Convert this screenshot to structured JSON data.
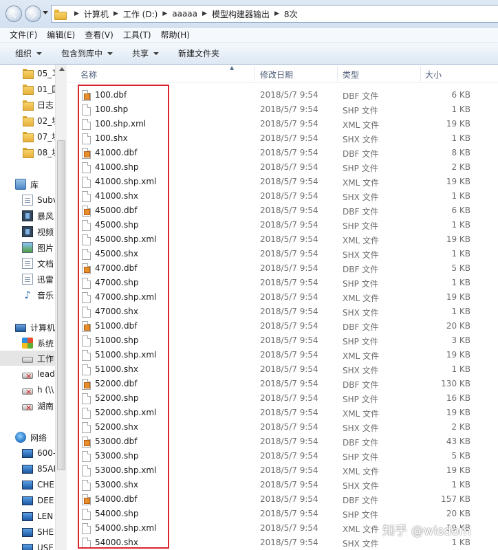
{
  "address": {
    "crumbs": [
      "计算机",
      "工作 (D:)",
      "aaaaa",
      "模型构建器输出",
      "8次"
    ]
  },
  "menu": [
    "文件(F)",
    "编辑(E)",
    "查看(V)",
    "工具(T)",
    "帮助(H)"
  ],
  "toolbar": {
    "organize": "组织",
    "include_library": "包含到库中",
    "share": "共享",
    "new_folder": "新建文件夹"
  },
  "nav": {
    "items": [
      {
        "label": "05_习",
        "icon": "folder-icon"
      },
      {
        "label": "01_国",
        "icon": "folder-icon"
      },
      {
        "label": "日志",
        "icon": "folder-icon"
      },
      {
        "label": "02_块",
        "icon": "folder-icon"
      },
      {
        "label": "07_块",
        "icon": "folder-icon"
      },
      {
        "label": "08_块",
        "icon": "folder-icon"
      },
      {
        "label": "库",
        "icon": "library-icon"
      },
      {
        "label": "Subv",
        "icon": "document-icon"
      },
      {
        "label": "暴风",
        "icon": "video-icon"
      },
      {
        "label": "视频",
        "icon": "video-icon"
      },
      {
        "label": "图片",
        "icon": "picture-icon"
      },
      {
        "label": "文档",
        "icon": "document-icon"
      },
      {
        "label": "迅雷",
        "icon": "document-icon"
      },
      {
        "label": "音乐",
        "icon": "music-icon"
      },
      {
        "label": "计算机",
        "icon": "computer-icon"
      },
      {
        "label": "系统",
        "icon": "windows-drive-icon"
      },
      {
        "label": "工作",
        "icon": "drive-icon"
      },
      {
        "label": "lead",
        "icon": "network-drive-icon"
      },
      {
        "label": "h (\\\\",
        "icon": "network-drive-icon"
      },
      {
        "label": "湖南",
        "icon": "network-drive-icon"
      },
      {
        "label": "网络",
        "icon": "network-icon"
      },
      {
        "label": "600-",
        "icon": "monitor-icon"
      },
      {
        "label": "85AI",
        "icon": "monitor-icon"
      },
      {
        "label": "CHE",
        "icon": "monitor-icon"
      },
      {
        "label": "DEE",
        "icon": "monitor-icon"
      },
      {
        "label": "LEN",
        "icon": "monitor-icon"
      },
      {
        "label": "SHE",
        "icon": "monitor-icon"
      },
      {
        "label": "USE",
        "icon": "monitor-icon"
      }
    ]
  },
  "columns": {
    "name": "名称",
    "date": "修改日期",
    "type": "类型",
    "size": "大小"
  },
  "files": [
    {
      "name": "100.dbf",
      "date": "2018/5/7 9:54",
      "type": "DBF 文件",
      "size": "6 KB"
    },
    {
      "name": "100.shp",
      "date": "2018/5/7 9:54",
      "type": "SHP 文件",
      "size": "1 KB"
    },
    {
      "name": "100.shp.xml",
      "date": "2018/5/7 9:54",
      "type": "XML 文件",
      "size": "19 KB"
    },
    {
      "name": "100.shx",
      "date": "2018/5/7 9:54",
      "type": "SHX 文件",
      "size": "1 KB"
    },
    {
      "name": "41000.dbf",
      "date": "2018/5/7 9:54",
      "type": "DBF 文件",
      "size": "8 KB"
    },
    {
      "name": "41000.shp",
      "date": "2018/5/7 9:54",
      "type": "SHP 文件",
      "size": "2 KB"
    },
    {
      "name": "41000.shp.xml",
      "date": "2018/5/7 9:54",
      "type": "XML 文件",
      "size": "19 KB"
    },
    {
      "name": "41000.shx",
      "date": "2018/5/7 9:54",
      "type": "SHX 文件",
      "size": "1 KB"
    },
    {
      "name": "45000.dbf",
      "date": "2018/5/7 9:54",
      "type": "DBF 文件",
      "size": "6 KB"
    },
    {
      "name": "45000.shp",
      "date": "2018/5/7 9:54",
      "type": "SHP 文件",
      "size": "1 KB"
    },
    {
      "name": "45000.shp.xml",
      "date": "2018/5/7 9:54",
      "type": "XML 文件",
      "size": "19 KB"
    },
    {
      "name": "45000.shx",
      "date": "2018/5/7 9:54",
      "type": "SHX 文件",
      "size": "1 KB"
    },
    {
      "name": "47000.dbf",
      "date": "2018/5/7 9:54",
      "type": "DBF 文件",
      "size": "5 KB"
    },
    {
      "name": "47000.shp",
      "date": "2018/5/7 9:54",
      "type": "SHP 文件",
      "size": "1 KB"
    },
    {
      "name": "47000.shp.xml",
      "date": "2018/5/7 9:54",
      "type": "XML 文件",
      "size": "19 KB"
    },
    {
      "name": "47000.shx",
      "date": "2018/5/7 9:54",
      "type": "SHX 文件",
      "size": "1 KB"
    },
    {
      "name": "51000.dbf",
      "date": "2018/5/7 9:54",
      "type": "DBF 文件",
      "size": "20 KB"
    },
    {
      "name": "51000.shp",
      "date": "2018/5/7 9:54",
      "type": "SHP 文件",
      "size": "3 KB"
    },
    {
      "name": "51000.shp.xml",
      "date": "2018/5/7 9:54",
      "type": "XML 文件",
      "size": "19 KB"
    },
    {
      "name": "51000.shx",
      "date": "2018/5/7 9:54",
      "type": "SHX 文件",
      "size": "1 KB"
    },
    {
      "name": "52000.dbf",
      "date": "2018/5/7 9:54",
      "type": "DBF 文件",
      "size": "130 KB"
    },
    {
      "name": "52000.shp",
      "date": "2018/5/7 9:54",
      "type": "SHP 文件",
      "size": "16 KB"
    },
    {
      "name": "52000.shp.xml",
      "date": "2018/5/7 9:54",
      "type": "XML 文件",
      "size": "19 KB"
    },
    {
      "name": "52000.shx",
      "date": "2018/5/7 9:54",
      "type": "SHX 文件",
      "size": "2 KB"
    },
    {
      "name": "53000.dbf",
      "date": "2018/5/7 9:54",
      "type": "DBF 文件",
      "size": "43 KB"
    },
    {
      "name": "53000.shp",
      "date": "2018/5/7 9:54",
      "type": "SHP 文件",
      "size": "5 KB"
    },
    {
      "name": "53000.shp.xml",
      "date": "2018/5/7 9:54",
      "type": "XML 文件",
      "size": "19 KB"
    },
    {
      "name": "53000.shx",
      "date": "2018/5/7 9:54",
      "type": "SHX 文件",
      "size": "1 KB"
    },
    {
      "name": "54000.dbf",
      "date": "2018/5/7 9:54",
      "type": "DBF 文件",
      "size": "157 KB"
    },
    {
      "name": "54000.shp",
      "date": "2018/5/7 9:54",
      "type": "SHP 文件",
      "size": "20 KB"
    },
    {
      "name": "54000.shp.xml",
      "date": "2018/5/7 9:54",
      "type": "XML 文件",
      "size": "19 KB"
    },
    {
      "name": "54000.shx",
      "date": "2018/5/7 9:54",
      "type": "SHX 文件",
      "size": "1 KB"
    }
  ],
  "watermark": "知乎 @wisdom",
  "colors": {
    "highlight": "#d8262c",
    "dbf_icon": "#e7902a"
  }
}
